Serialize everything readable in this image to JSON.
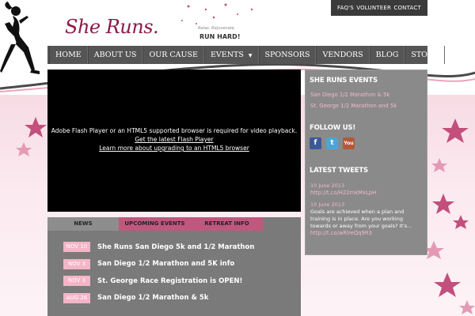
{
  "utility_nav": [
    "FAQ'S",
    "VOLUNTEER",
    "CONTACT"
  ],
  "brand": {
    "logo_text": "She Runs.",
    "tagline_small": "Relax, Rejuvenate,",
    "tagline": "RUN HARD!"
  },
  "main_nav": [
    {
      "label": "HOME"
    },
    {
      "label": "ABOUT US"
    },
    {
      "label": "OUR CAUSE"
    },
    {
      "label": "EVENTS",
      "has_dropdown": true
    },
    {
      "label": "SPONSORS"
    },
    {
      "label": "VENDORS"
    },
    {
      "label": "BLOG"
    },
    {
      "label": "STORE"
    }
  ],
  "video": {
    "message": "Adobe Flash Player or an HTML5 supported browser is required for video playback.",
    "link1": "Get the latest Flash Player",
    "link2": "Learn more about upgrading to an HTML5 browser"
  },
  "news_tabs": [
    "NEWS",
    "UPCOMING EVENTS",
    "RETREAT INFO"
  ],
  "news_items": [
    {
      "date": "NOV 10",
      "title": "She Runs San Diego 5k and 1/2 Marathon"
    },
    {
      "date": "NOV 3",
      "title": "San Diego 1/2 Marathon and 5K info"
    },
    {
      "date": "NOV 3",
      "title": "St. George Race Registration is OPEN!"
    },
    {
      "date": "AUG 26",
      "title": "San Diego 1/2 Marathon & 5k"
    }
  ],
  "sidebar": {
    "events_heading": "SHE RUNS EVENTS",
    "events": [
      "San Diego 1/2 Marathon & 5k",
      "St. George 1/2 Marathon and 5k"
    ],
    "follow_heading": "FOLLOW US!",
    "social": [
      "facebook-icon",
      "twitter-icon",
      "youtube-icon"
    ],
    "tweets_heading": "LATEST TWEETS",
    "tweets": [
      {
        "date": "10 June 2013",
        "text": "",
        "link": "http://t.co/H22mkMxLpH"
      },
      {
        "date": "10 June 2013",
        "text": "Goals are achieved when a plan and training is in place. Are you working towards or away from your goals? It's...",
        "link": "http://t.co/wRlreQq9R3"
      }
    ]
  },
  "colors": {
    "brand": "#8c1a4a",
    "nav_bg": "#555555",
    "panel_bg": "#7a7a7a",
    "accent_pink": "#c0587d",
    "badge_pink": "#f3b5c8",
    "link_pink": "#f4b8cb"
  }
}
